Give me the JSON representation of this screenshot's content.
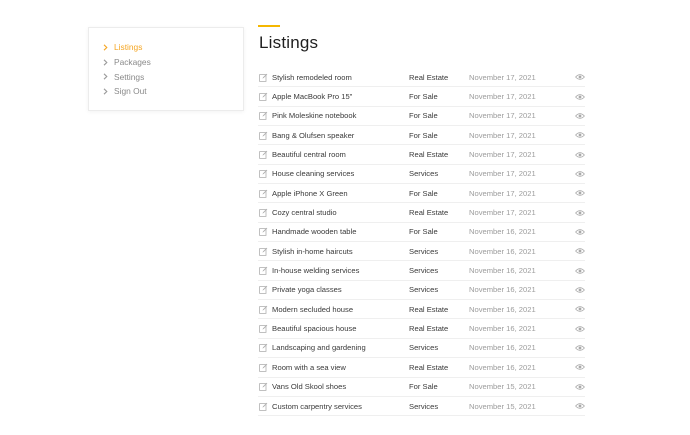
{
  "sidebar": {
    "items": [
      {
        "label": "Listings",
        "active": true
      },
      {
        "label": "Packages",
        "active": false
      },
      {
        "label": "Settings",
        "active": false
      },
      {
        "label": "Sign Out",
        "active": false
      }
    ]
  },
  "page": {
    "title": "Listings"
  },
  "colors": {
    "accent": "#f5a623",
    "muted": "#9c9c9c"
  },
  "icons": {
    "row_action": "edit-icon",
    "row_view": "eye-icon",
    "sidebar_bullet": "chevron-right-icon"
  },
  "listings": [
    {
      "name": "Stylish remodeled room",
      "category": "Real Estate",
      "date": "November 17, 2021"
    },
    {
      "name": "Apple MacBook Pro 15\"",
      "category": "For Sale",
      "date": "November 17, 2021"
    },
    {
      "name": "Pink Moleskine notebook",
      "category": "For Sale",
      "date": "November 17, 2021"
    },
    {
      "name": "Bang & Olufsen speaker",
      "category": "For Sale",
      "date": "November 17, 2021"
    },
    {
      "name": "Beautiful central room",
      "category": "Real Estate",
      "date": "November 17, 2021"
    },
    {
      "name": "House cleaning services",
      "category": "Services",
      "date": "November 17, 2021"
    },
    {
      "name": "Apple iPhone X Green",
      "category": "For Sale",
      "date": "November 17, 2021"
    },
    {
      "name": "Cozy central studio",
      "category": "Real Estate",
      "date": "November 17, 2021"
    },
    {
      "name": "Handmade wooden table",
      "category": "For Sale",
      "date": "November 16, 2021"
    },
    {
      "name": "Stylish in-home haircuts",
      "category": "Services",
      "date": "November 16, 2021"
    },
    {
      "name": "In-house welding services",
      "category": "Services",
      "date": "November 16, 2021"
    },
    {
      "name": "Private yoga classes",
      "category": "Services",
      "date": "November 16, 2021"
    },
    {
      "name": "Modern secluded house",
      "category": "Real Estate",
      "date": "November 16, 2021"
    },
    {
      "name": "Beautiful spacious house",
      "category": "Real Estate",
      "date": "November 16, 2021"
    },
    {
      "name": "Landscaping and gardening",
      "category": "Services",
      "date": "November 16, 2021"
    },
    {
      "name": "Room with a sea view",
      "category": "Real Estate",
      "date": "November 16, 2021"
    },
    {
      "name": "Vans Old Skool shoes",
      "category": "For Sale",
      "date": "November 15, 2021"
    },
    {
      "name": "Custom carpentry services",
      "category": "Services",
      "date": "November 15, 2021"
    }
  ]
}
